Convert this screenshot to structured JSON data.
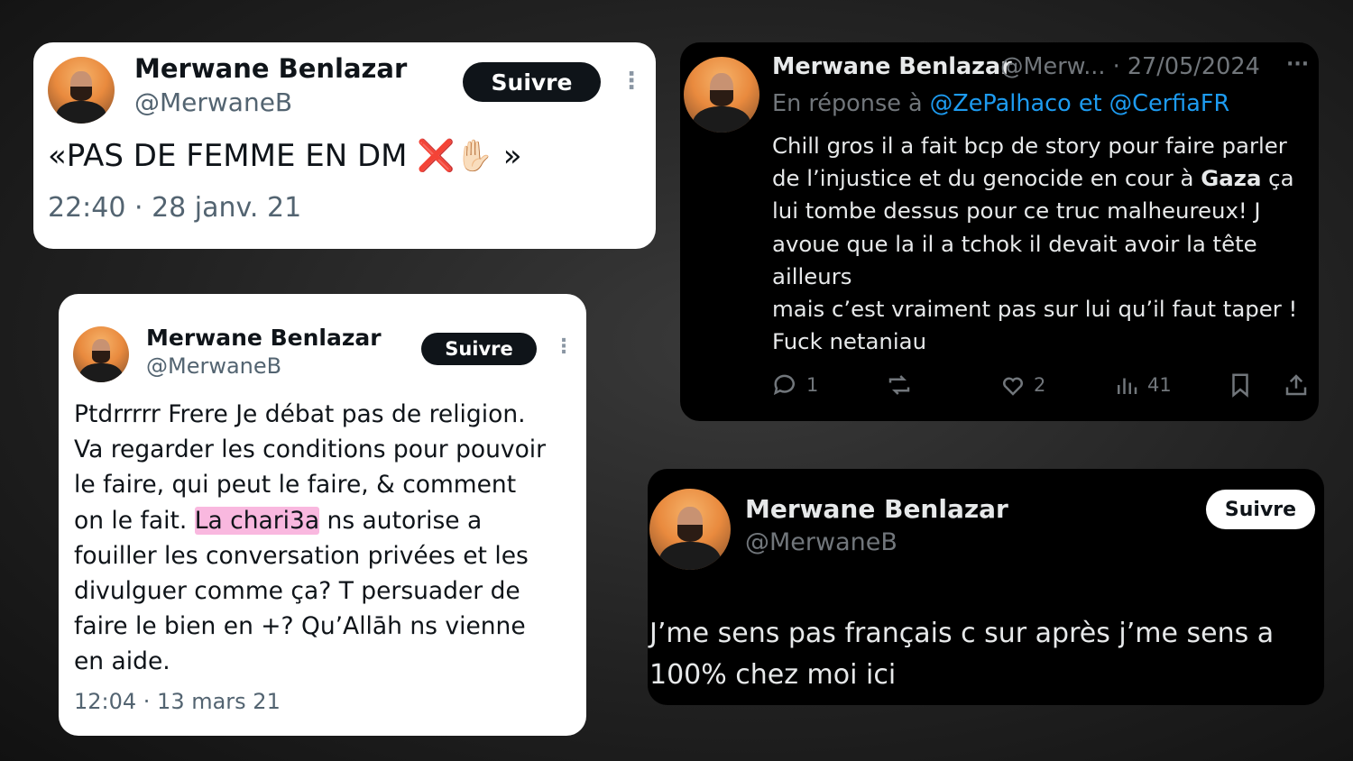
{
  "tweet1": {
    "name": "Merwane Benlazar",
    "handle": "@MerwaneB",
    "follow_label": "Suivre",
    "more": "⋮",
    "text": "«PAS DE FEMME EN DM ❌✋🏻 »",
    "timestamp": "22:40 · 28 janv. 21"
  },
  "tweet2": {
    "name": "Merwane Benlazar",
    "handle": "@MerwaneB",
    "follow_label": "Suivre",
    "more": "⋮",
    "text_before": "Ptdrrrrr Frere Je débat pas de religion.\nVa regarder les conditions pour pouvoir\nle faire, qui peut le faire, & comment\non le fait. ",
    "text_highlight": "La chari3a",
    "text_after": " ns autorise a\nfouiller les conversation privées et les\ndivulguer comme ça? T persuader de\nfaire le bien en +? Qu’Allāh ns vienne\nen aide.",
    "timestamp": "12:04 · 13 mars 21"
  },
  "tweet3": {
    "name": "Merwane Benlazar",
    "handle_date": "@Merw... · 27/05/2024",
    "more": "···",
    "reply_prefix": "En réponse à",
    "reply_targets": "@ZePalhaco et @CerfiaFR",
    "text_before": "Chill gros il a fait bcp de story pour faire parler\nde l’injustice et du genocide en cour à ",
    "text_bold": "Gaza",
    "text_after": " ça\nlui tombe dessus pour ce truc malheureux! J\navoue que la il a tchok il devait avoir la tête\nailleurs\nmais c’est vraiment pas sur lui qu’il faut taper !\nFuck netaniau",
    "replies": "1",
    "likes": "2",
    "views": "41",
    "icons": [
      "reply-icon",
      "retweet-icon",
      "like-icon",
      "views-icon",
      "bookmark-icon",
      "share-icon"
    ]
  },
  "tweet4": {
    "name": "Merwane Benlazar",
    "handle": "@MerwaneB",
    "follow_label": "Suivre",
    "text": "J’me sens pas français c sur après j’me sens a\n100% chez moi ici"
  }
}
